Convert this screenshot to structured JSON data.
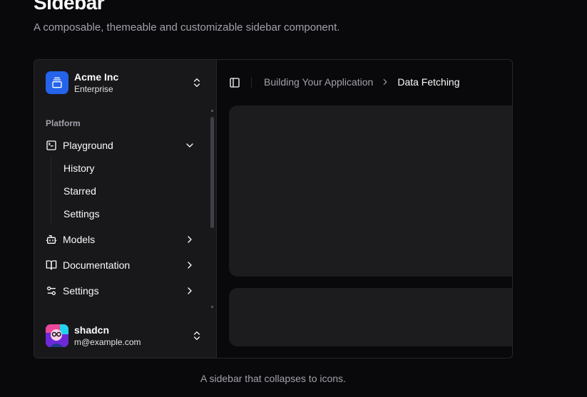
{
  "page": {
    "heading": "Sidebar",
    "description": "A composable, themeable and customizable sidebar component.",
    "caption": "A sidebar that collapses to icons."
  },
  "team": {
    "name": "Acme Inc",
    "plan": "Enterprise",
    "logo_color": "#2563eb"
  },
  "nav": {
    "group_label": "Platform",
    "items": [
      {
        "label": "Playground",
        "icon": "terminal-square-icon",
        "expanded": true,
        "subitems": [
          "History",
          "Starred",
          "Settings"
        ]
      },
      {
        "label": "Models",
        "icon": "bot-icon",
        "expanded": false
      },
      {
        "label": "Documentation",
        "icon": "book-open-icon",
        "expanded": false
      },
      {
        "label": "Settings",
        "icon": "settings-2-icon",
        "expanded": false
      }
    ]
  },
  "user": {
    "name": "shadcn",
    "email": "m@example.com"
  },
  "header": {
    "breadcrumb_parent": "Building Your Application",
    "breadcrumb_current": "Data Fetching"
  },
  "colors": {
    "background": "#09090b",
    "sidebar": "#18181b",
    "border": "#27272a",
    "muted_text": "#a1a1aa",
    "card": "#1c1c1f"
  }
}
